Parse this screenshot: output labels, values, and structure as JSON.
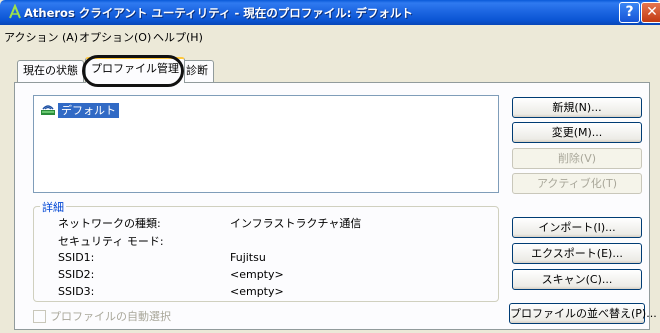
{
  "window": {
    "title": "Atheros クライアント ユーティリティ - 現在のプロファイル: デフォルト",
    "help_glyph": "?",
    "close_glyph": "✕",
    "icon": "atheros-logo-icon"
  },
  "menu": {
    "items": [
      {
        "label": "アクション (A)"
      },
      {
        "label": "オプション(O)"
      },
      {
        "label": "ヘルプ(H)"
      }
    ]
  },
  "tabs": [
    {
      "label": "現在の状態",
      "active": false
    },
    {
      "label": "プロファイル管理",
      "active": true
    },
    {
      "label": "診断",
      "active": false
    }
  ],
  "profiles": {
    "items": [
      {
        "label": "デフォルト",
        "selected": true,
        "icon": "wireless-profile-icon"
      }
    ]
  },
  "details": {
    "legend": "詳細",
    "rows": [
      {
        "label": "ネットワークの種類:",
        "value": "インフラストラクチャ通信"
      },
      {
        "label": "セキュリティ モード:",
        "value": ""
      },
      {
        "label": "SSID1:",
        "value": "Fujitsu"
      },
      {
        "label": "SSID2:",
        "value": "<empty>"
      },
      {
        "label": "SSID3:",
        "value": "<empty>"
      }
    ]
  },
  "buttons": {
    "new": {
      "label": "新規(N)...",
      "enabled": true
    },
    "modify": {
      "label": "変更(M)...",
      "enabled": true
    },
    "remove": {
      "label": "削除(V)",
      "enabled": false
    },
    "activate": {
      "label": "アクティブ化(T)",
      "enabled": false
    },
    "import": {
      "label": "インポート(I)...",
      "enabled": true
    },
    "export": {
      "label": "エクスポート(E)...",
      "enabled": true
    },
    "scan": {
      "label": "スキャン(C)...",
      "enabled": true
    },
    "order": {
      "label": "プロファイルの並べ替え(P)...",
      "enabled": true
    }
  },
  "auto_select": {
    "label": "プロファイルの自動選択",
    "checked": false,
    "enabled": false
  },
  "colors": {
    "title_bar": "#0b55d4",
    "selection": "#316ac5",
    "tab_accent": "#ffc83c",
    "group_legend": "#0046d5",
    "disabled_text": "#a9a79a"
  }
}
